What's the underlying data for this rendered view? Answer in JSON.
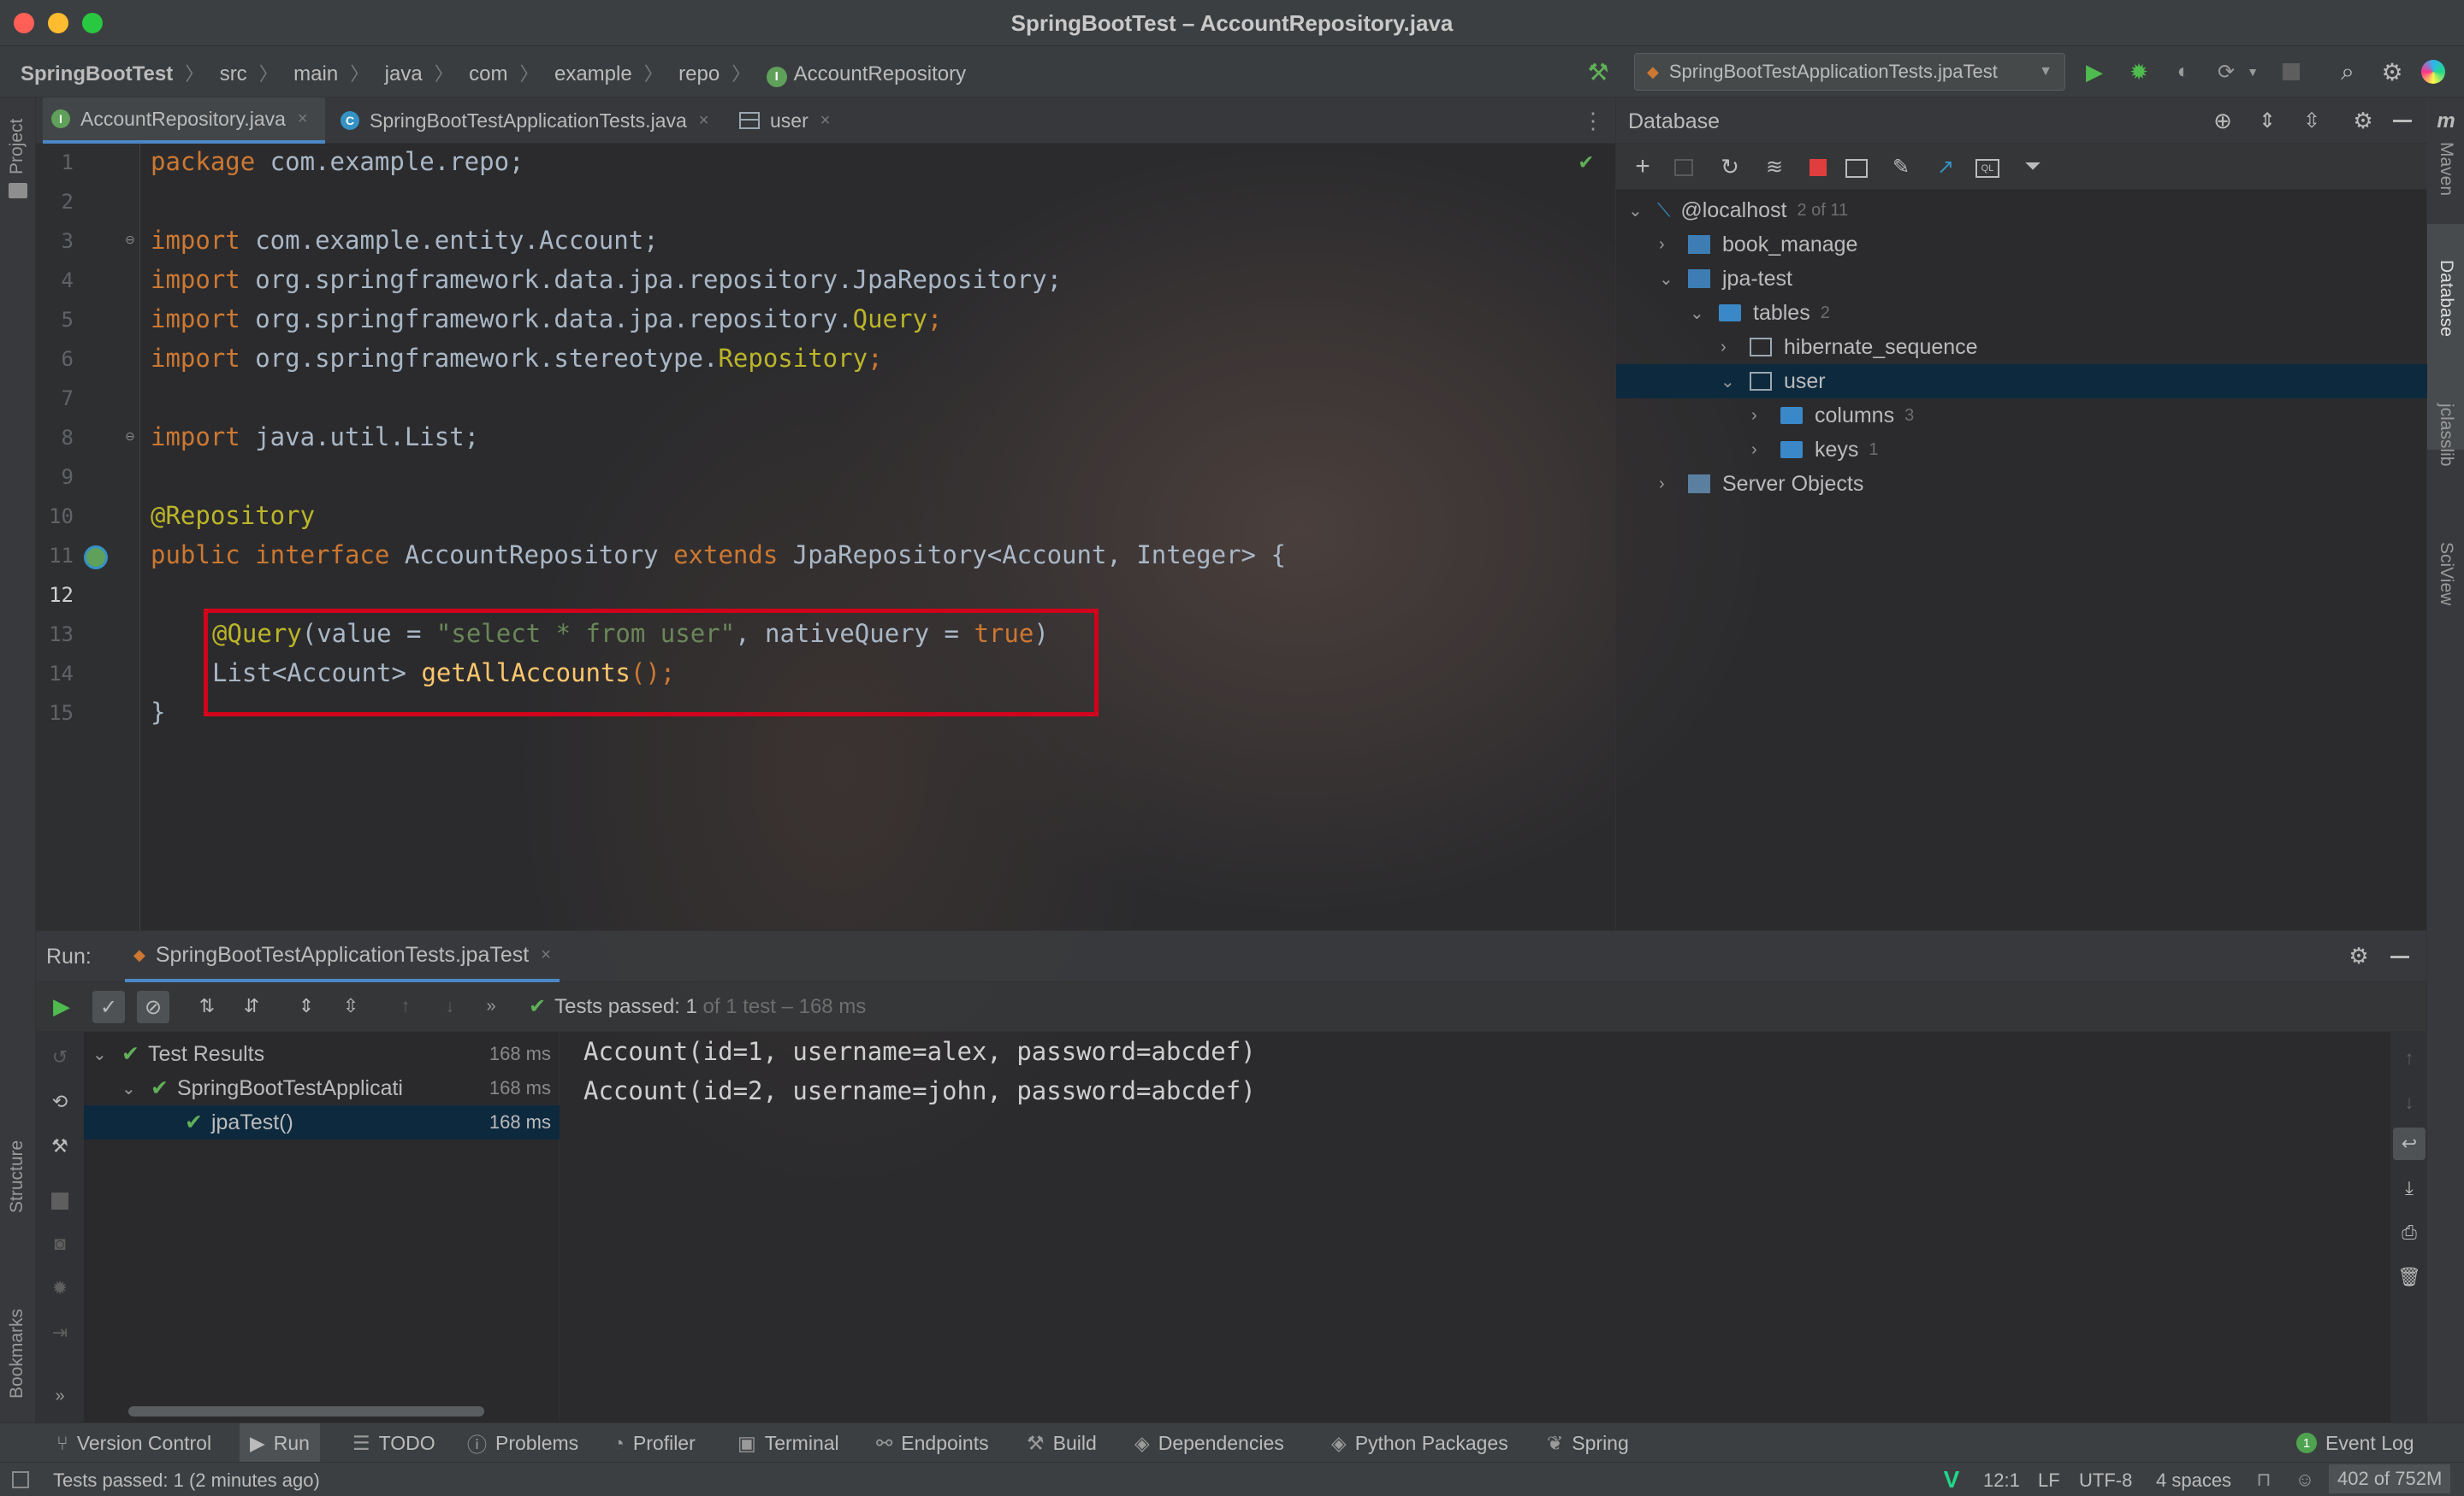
{
  "window": {
    "title": "SpringBootTest – AccountRepository.java"
  },
  "breadcrumb": {
    "project": "SpringBootTest",
    "items": [
      "src",
      "main",
      "java",
      "com",
      "example",
      "repo"
    ],
    "last": "AccountRepository"
  },
  "run_config": {
    "label": "SpringBootTestApplicationTests.jpaTest"
  },
  "editor": {
    "tabs": [
      {
        "label": "AccountRepository.java",
        "icon": "interface-icon",
        "active": true
      },
      {
        "label": "SpringBootTestApplicationTests.java",
        "icon": "class-icon",
        "active": false
      },
      {
        "label": "user",
        "icon": "table-icon",
        "active": false
      }
    ],
    "line_numbers": [
      "1",
      "2",
      "3",
      "4",
      "5",
      "6",
      "7",
      "8",
      "9",
      "10",
      "11",
      "12",
      "13",
      "14",
      "15"
    ],
    "current_line": "12",
    "code": {
      "l1": {
        "a": "package",
        "b": " com.example.repo;"
      },
      "l3": {
        "a": "import",
        "b": " com.example.entity.Account;"
      },
      "l4": {
        "a": "import",
        "b": " org.springframework.data.jpa.repository.JpaRepository;"
      },
      "l5": {
        "a": "import",
        "b": " org.springframework.data.jpa.repository.",
        "c": "Query",
        "d": ";"
      },
      "l6": {
        "a": "import",
        "b": " org.springframework.stereotype.",
        "c": "Repository",
        "d": ";"
      },
      "l8": {
        "a": "import",
        "b": " java.util.List;"
      },
      "l10": {
        "a": "@Repository"
      },
      "l11": {
        "a": "public interface",
        "b": " AccountRepository ",
        "c": "extends",
        "d": " JpaRepository<Account, Integer> {"
      },
      "l13": {
        "a": "@Query",
        "b": "(value = ",
        "c": "\"select * from user\"",
        "d": ", nativeQuery = ",
        "e": "true",
        "f": ")"
      },
      "l14": {
        "a": "List<Account> ",
        "b": "getAllAccounts",
        "c": "();"
      },
      "l15": {
        "a": "}"
      }
    },
    "highlight_color": "#d0021b"
  },
  "database": {
    "title": "Database",
    "tree": [
      {
        "label": "@localhost",
        "count": "2 of 11"
      },
      {
        "label": "book_manage",
        "count": ""
      },
      {
        "label": "jpa-test",
        "count": ""
      },
      {
        "label": "tables",
        "count": "2"
      },
      {
        "label": "hibernate_sequence",
        "count": ""
      },
      {
        "label": "user",
        "count": ""
      },
      {
        "label": "columns",
        "count": "3"
      },
      {
        "label": "keys",
        "count": "1"
      },
      {
        "label": "Server Objects",
        "count": ""
      }
    ]
  },
  "run": {
    "label": "Run:",
    "config": "SpringBootTestApplicationTests.jpaTest",
    "status": {
      "passed": "Tests passed: 1",
      "rest": "of 1 test – 168 ms"
    },
    "tree": [
      {
        "label": "Test Results",
        "time": "168 ms"
      },
      {
        "label": "SpringBootTestApplicati",
        "time": "168 ms"
      },
      {
        "label": "jpaTest()",
        "time": "168 ms"
      }
    ],
    "output": [
      "Account(id=1, username=alex, password=abcdef)",
      "Account(id=2, username=john, password=abcdef)"
    ]
  },
  "toolwindows": [
    "Version Control",
    "Run",
    "TODO",
    "Problems",
    "Profiler",
    "Terminal",
    "Endpoints",
    "Build",
    "Dependencies",
    "Python Packages",
    "Spring"
  ],
  "event_log": {
    "count": "1",
    "label": "Event Log"
  },
  "side_left": [
    "Project",
    "Structure",
    "Bookmarks"
  ],
  "side_right": [
    "Maven",
    "Database",
    "jclasslib",
    "SciView"
  ],
  "statusbar": {
    "message": "Tests passed: 1 (2 minutes ago)",
    "position": "12:1",
    "line_sep": "LF",
    "encoding": "UTF-8",
    "indent": "4 spaces",
    "memory": "402 of 752M"
  }
}
